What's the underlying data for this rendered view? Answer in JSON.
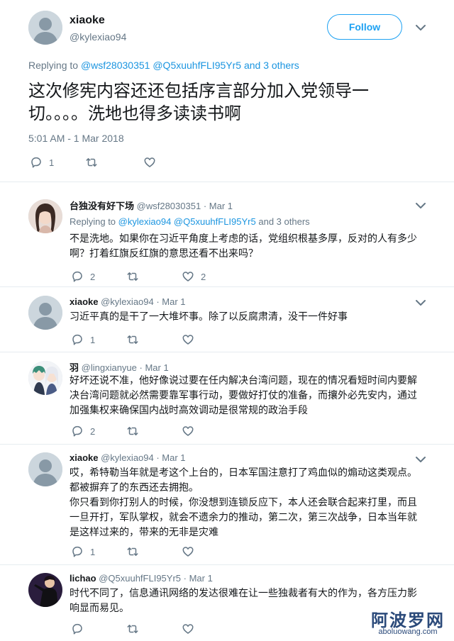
{
  "main_tweet": {
    "name": "xiaoke",
    "handle": "@kylexiao94",
    "follow_label": "Follow",
    "replying_prefix": "Replying to",
    "replying_mentions": [
      "@wsf28030351",
      "@Q5xuuhfFLI95Yr5"
    ],
    "replying_others": "and 3 others",
    "text": "这次修宪内容还还包括序言部分加入党领导一切。。。。洗地也得多读读书啊",
    "timestamp": "5:01 AM - 1 Mar 2018",
    "reply_count": "1"
  },
  "replies": [
    {
      "name": "台独没有好下场",
      "handle": "@wsf28030351",
      "date": "· Mar 1",
      "replying_prefix": "Replying to",
      "replying_mentions": [
        "@kylexiao94",
        "@Q5xuuhfFLI95Yr5"
      ],
      "replying_others": "and 3 others",
      "text": "不是洗地。如果你在习近平角度上考虑的话，党组织根基多厚，反对的人有多少啊？打着红旗反红旗的意思还看不出来吗？",
      "reply_count": "2",
      "like_count": "2"
    },
    {
      "name": "xiaoke",
      "handle": "@kylexiao94",
      "date": "· Mar 1",
      "text": "习近平真的是干了一大堆坏事。除了以反腐肃清，没干一件好事",
      "reply_count": "1",
      "like_count": ""
    },
    {
      "name": "羽",
      "handle": "@lingxianyue",
      "date": "· Mar 1",
      "text": "好坏还说不准，他好像说过要在任内解决台湾问题，现在的情况看短时间内要解决台湾问题就必然需要靠军事行动，要做好打仗的准备，而攘外必先安内，通过加强集权来确保国内战时高效调动是很常规的政治手段",
      "reply_count": "2",
      "like_count": ""
    },
    {
      "name": "xiaoke",
      "handle": "@kylexiao94",
      "date": "· Mar 1",
      "text_lines": [
        "哎，希特勒当年就是考这个上台的，日本军国注意打了鸡血似的煽动这类观点。都被摒弃了的东西还去拥抱。",
        "你只看到你打别人的时候，你没想到连锁反应下，本人还会联合起来打里，而且一旦开打，军队掌权，就会不遗余力的推动，第二次，第三次战争，日本当年就是这样过来的，带来的无非是灾难"
      ],
      "reply_count": "1",
      "like_count": ""
    },
    {
      "name": "lichao",
      "handle": "@Q5xuuhfFLI95Yr5",
      "date": "· Mar 1",
      "text": "时代不同了，信息通讯网络的发达很难在让一些独裁者有大的作为，各方压力影响显而易见。",
      "reply_count": "",
      "like_count": ""
    }
  ],
  "watermark": {
    "cn": "阿波罗网",
    "en": "aboluowang.com"
  },
  "icons": [
    "reply-icon",
    "retweet-icon",
    "like-icon",
    "chevron-down-icon"
  ],
  "colors": {
    "accent": "#1da1f2",
    "mention": "#1b95e0",
    "secondary_text": "#657786",
    "divider": "#e6ecf0"
  }
}
